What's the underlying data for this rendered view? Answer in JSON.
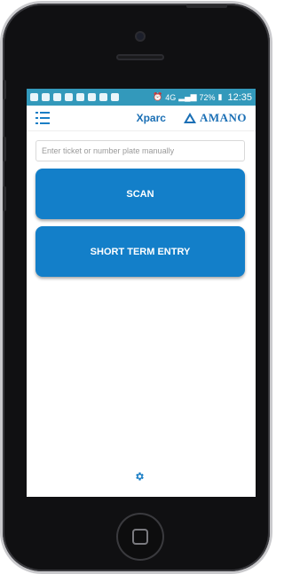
{
  "status_bar": {
    "network": "4G",
    "battery": "72%",
    "time": "12:35"
  },
  "app_bar": {
    "app_name": "Xparc",
    "brand": "AMANO",
    "menu_icon": "list-menu-icon",
    "logo_icon": "triangle-logo-icon"
  },
  "search": {
    "value": "",
    "placeholder": "Enter ticket or number plate manually"
  },
  "buttons": {
    "scan": "SCAN",
    "short_term_entry": "SHORT TERM ENTRY"
  },
  "footer": {
    "settings_icon": "gear-icon"
  },
  "colors": {
    "status_bar": "#3399bb",
    "primary": "#137fc9",
    "brand": "#1a6fb5"
  }
}
